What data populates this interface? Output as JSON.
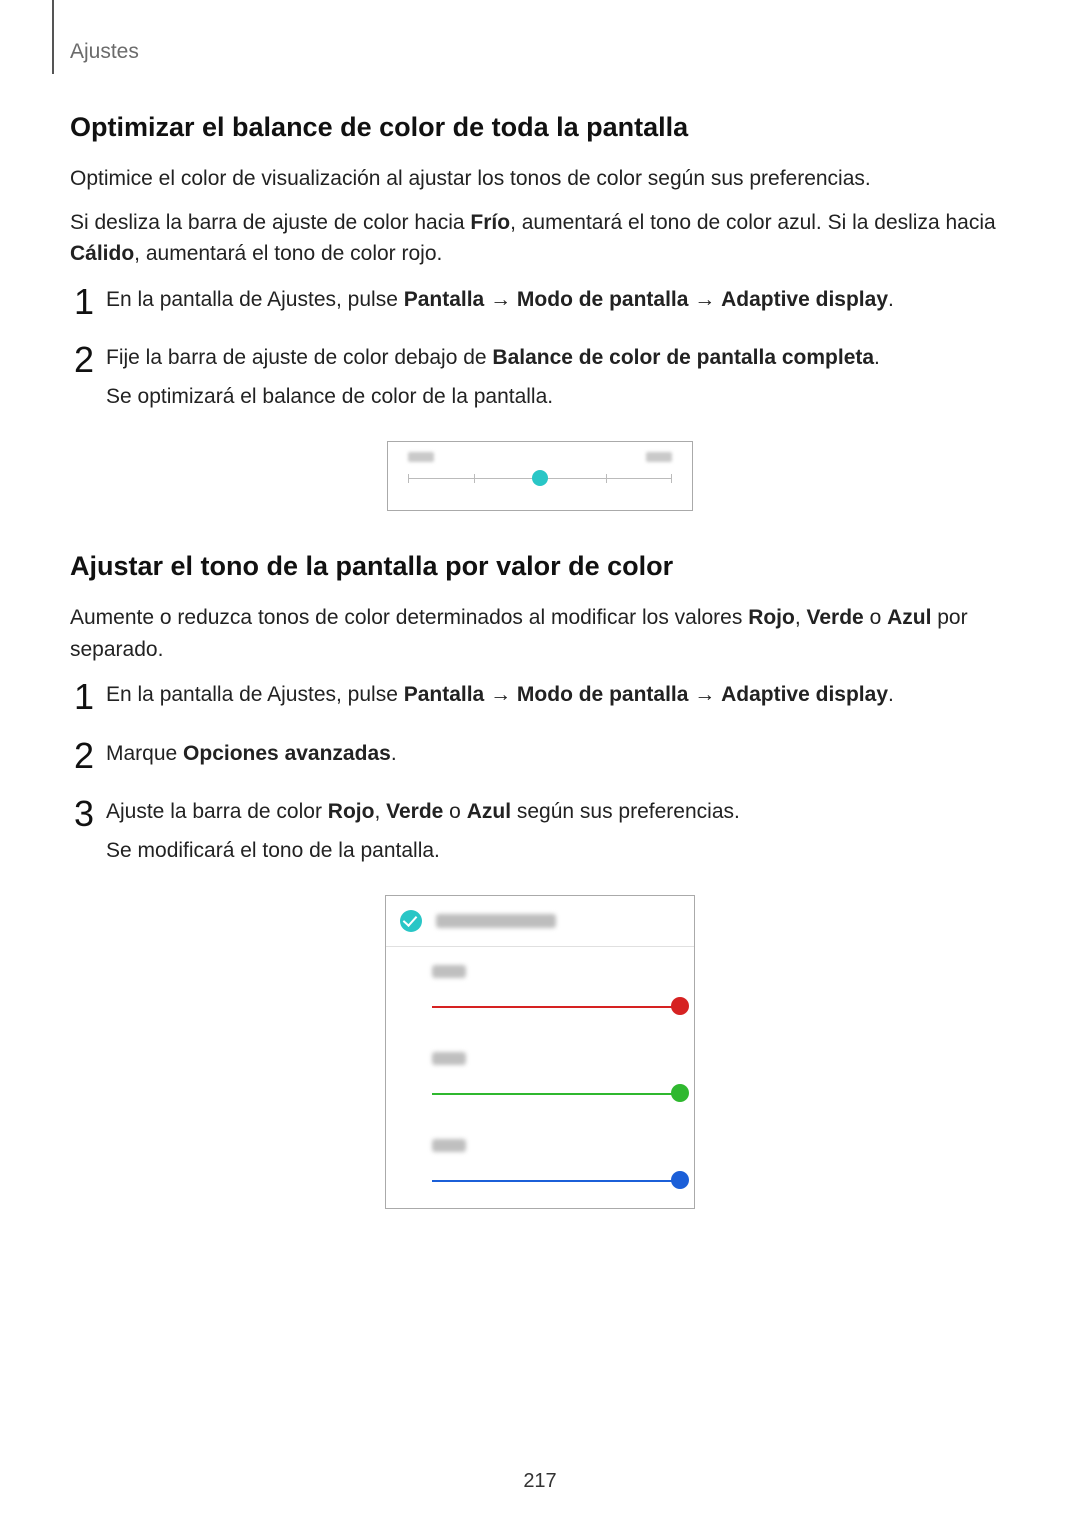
{
  "breadcrumb": "Ajustes",
  "section1": {
    "title": "Optimizar el balance de color de toda la pantalla",
    "p1": "Optimice el color de visualización al ajustar los tonos de color según sus preferencias.",
    "p2a": "Si desliza la barra de ajuste de color hacia ",
    "p2b_bold": "Frío",
    "p2c": ", aumentará el tono de color azul. Si la desliza hacia ",
    "p2d_bold": "Cálido",
    "p2e": ", aumentará el tono de color rojo.",
    "step1a": "En la pantalla de Ajustes, pulse ",
    "step1b_bold": "Pantalla",
    "step1c": " → ",
    "step1d_bold": "Modo de pantalla",
    "step1e": " → ",
    "step1f_bold": "Adaptive display",
    "step1g": ".",
    "step2a": "Fije la barra de ajuste de color debajo de ",
    "step2b_bold": "Balance de color de pantalla completa",
    "step2c": ".",
    "step2_p": "Se optimizará el balance de color de la pantalla."
  },
  "section2": {
    "title": "Ajustar el tono de la pantalla por valor de color",
    "p1a": "Aumente o reduzca tonos de color determinados al modificar los valores ",
    "p1_rojo": "Rojo",
    "p1b": ", ",
    "p1_verde": "Verde",
    "p1c": " o ",
    "p1_azul": "Azul",
    "p1d": " por separado.",
    "step1a": "En la pantalla de Ajustes, pulse ",
    "step1b_bold": "Pantalla",
    "step1c": " → ",
    "step1d_bold": "Modo de pantalla",
    "step1e": " → ",
    "step1f_bold": "Adaptive display",
    "step1g": ".",
    "step2a": "Marque ",
    "step2b_bold": "Opciones avanzadas",
    "step2c": ".",
    "step3a": "Ajuste la barra de color ",
    "step3_rojo": "Rojo",
    "step3b": ", ",
    "step3_verde": "Verde",
    "step3c": " o ",
    "step3_azul": "Azul",
    "step3d": " según sus preferencias.",
    "step3_p": "Se modificará el tono de la pantalla."
  },
  "pageNumber": "217"
}
